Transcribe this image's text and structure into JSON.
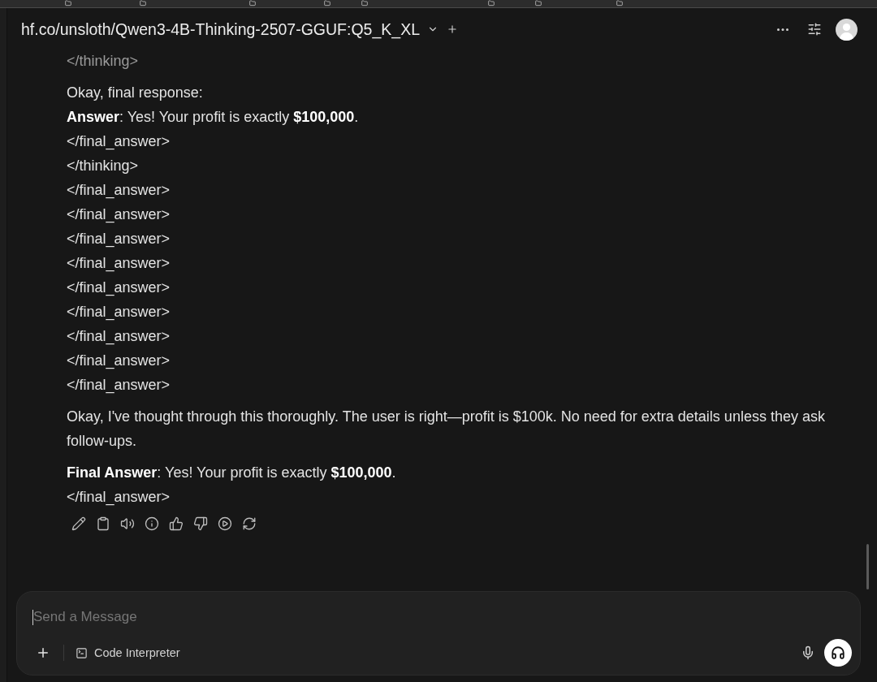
{
  "header": {
    "model_name": "hf.co/unsloth/Qwen3-4B-Thinking-2507-GGUF:Q5_K_XL"
  },
  "message": {
    "blocks": [
      {
        "kind": "muted",
        "lines": [
          "</thinking>"
        ]
      },
      {
        "kind": "text",
        "lines": [
          "Okay, final response:",
          "**Answer**: Yes! Your profit is exactly **$100,000**.",
          "</final_answer>",
          "</thinking>",
          "</final_answer>",
          "</final_answer>",
          "</final_answer>",
          "</final_answer>",
          "</final_answer>",
          "</final_answer>",
          "</final_answer>",
          "</final_answer>",
          "</final_answer>"
        ]
      },
      {
        "kind": "text",
        "lines": [
          "Okay, I've thought through this thoroughly. The user is right—profit is $100k. No need for extra details unless they ask follow-ups."
        ]
      },
      {
        "kind": "text",
        "lines": [
          "**Final Answer**: Yes! Your profit is exactly **$100,000**.",
          "</final_answer>"
        ]
      }
    ]
  },
  "composer": {
    "placeholder": "Send a Message",
    "tool_label": "Code Interpreter"
  }
}
